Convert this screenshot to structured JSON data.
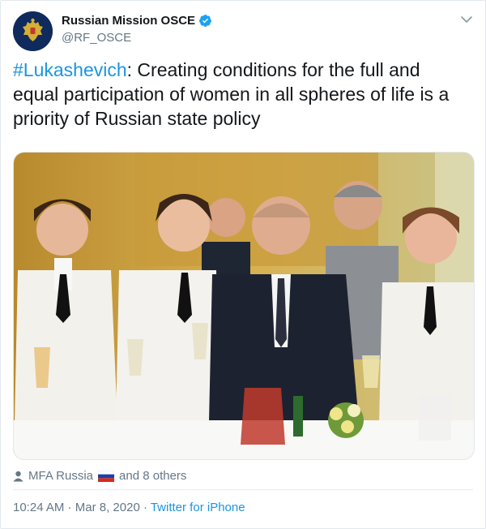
{
  "author": {
    "display_name": "Russian Mission OSCE",
    "handle": "@RF_OSCE",
    "verified": true,
    "avatar_icon": "russian-coat-of-arms-icon"
  },
  "tweet": {
    "hashtag": "#Lukashevich",
    "text": ": Creating conditions for the full and equal participation of women in all spheres of life is a priority of Russian state policy"
  },
  "photo": {
    "alt": ""
  },
  "tagged": {
    "icon": "person-icon",
    "first_user": "MFA Russia",
    "flag": "russia-flag-icon",
    "rest": "and 8 others"
  },
  "meta": {
    "time": "10:24 AM",
    "separator": " · ",
    "date": "Mar 8, 2020",
    "separator2": " · ",
    "source": "Twitter for iPhone"
  },
  "colors": {
    "link": "#1b95e0",
    "secondary": "#657786",
    "text": "#14171a",
    "avatar_bg": "#0f2a5c"
  }
}
